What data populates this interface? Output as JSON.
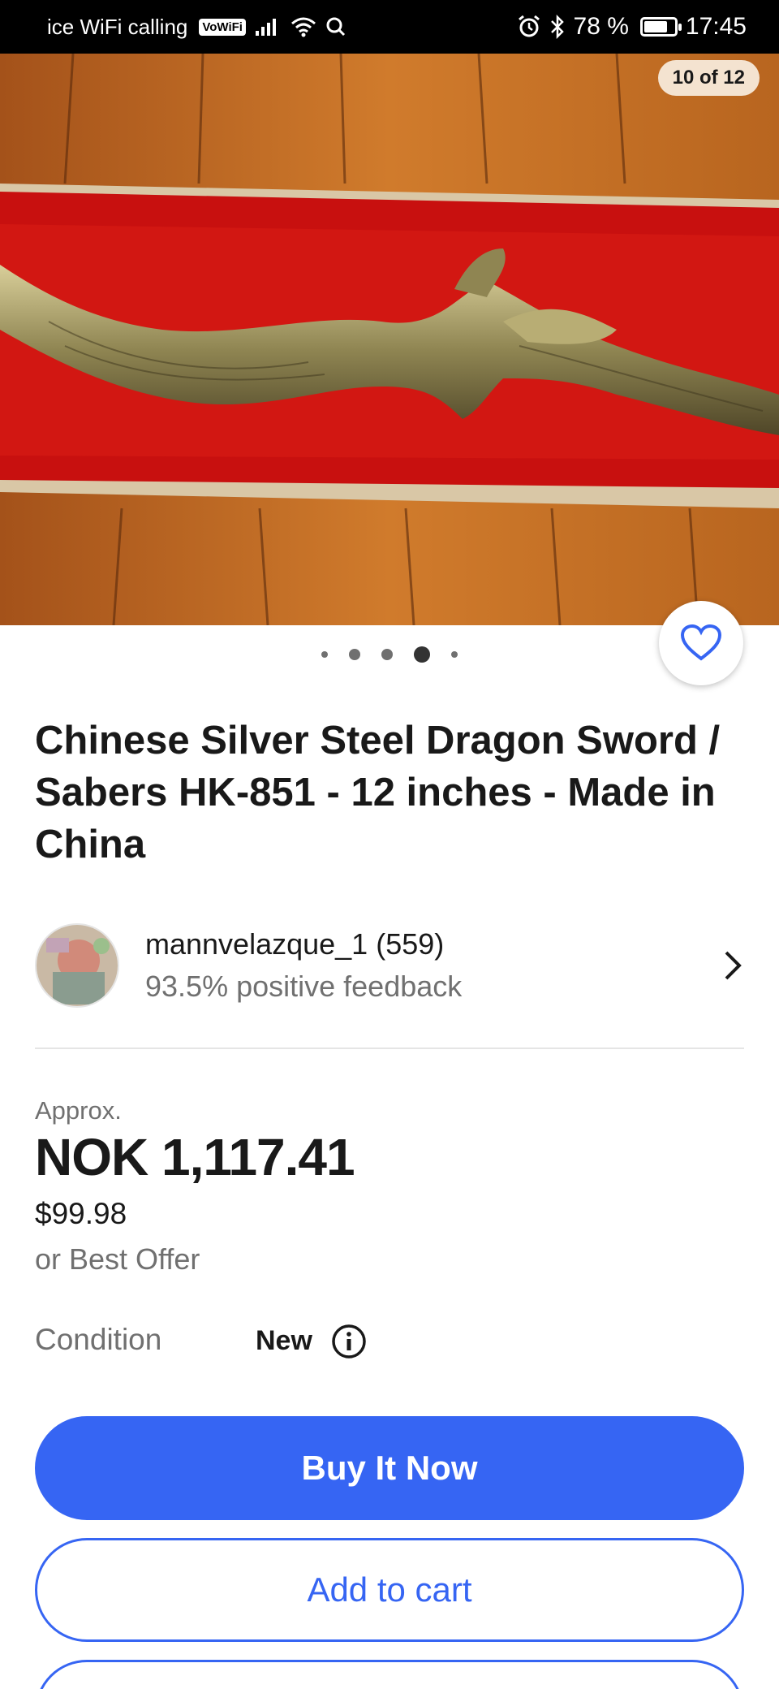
{
  "status_bar": {
    "carrier": "ice WiFi calling",
    "vowifi_badge": "VoWiFi",
    "battery": "78 %",
    "battery_level": 0.78,
    "time": "17:45"
  },
  "gallery": {
    "counter": "10 of 12",
    "dots": 5,
    "active_dot": 3
  },
  "listing": {
    "title": "Chinese  Silver Steel Dragon Sword / Sabers HK-851 - 12 inches - Made in China"
  },
  "seller": {
    "name": "mannvelazque_1 (559)",
    "feedback": "93.5% positive feedback"
  },
  "pricing": {
    "approx_label": "Approx.",
    "price": "NOK 1,117.41",
    "usd_price": "$99.98",
    "best_offer": "or Best Offer"
  },
  "condition": {
    "label": "Condition",
    "value": "New"
  },
  "actions": {
    "buy_now": "Buy It Now",
    "add_to_cart": "Add to cart"
  },
  "colors": {
    "accent": "#3665f3",
    "text": "#191919",
    "muted": "#707070"
  }
}
